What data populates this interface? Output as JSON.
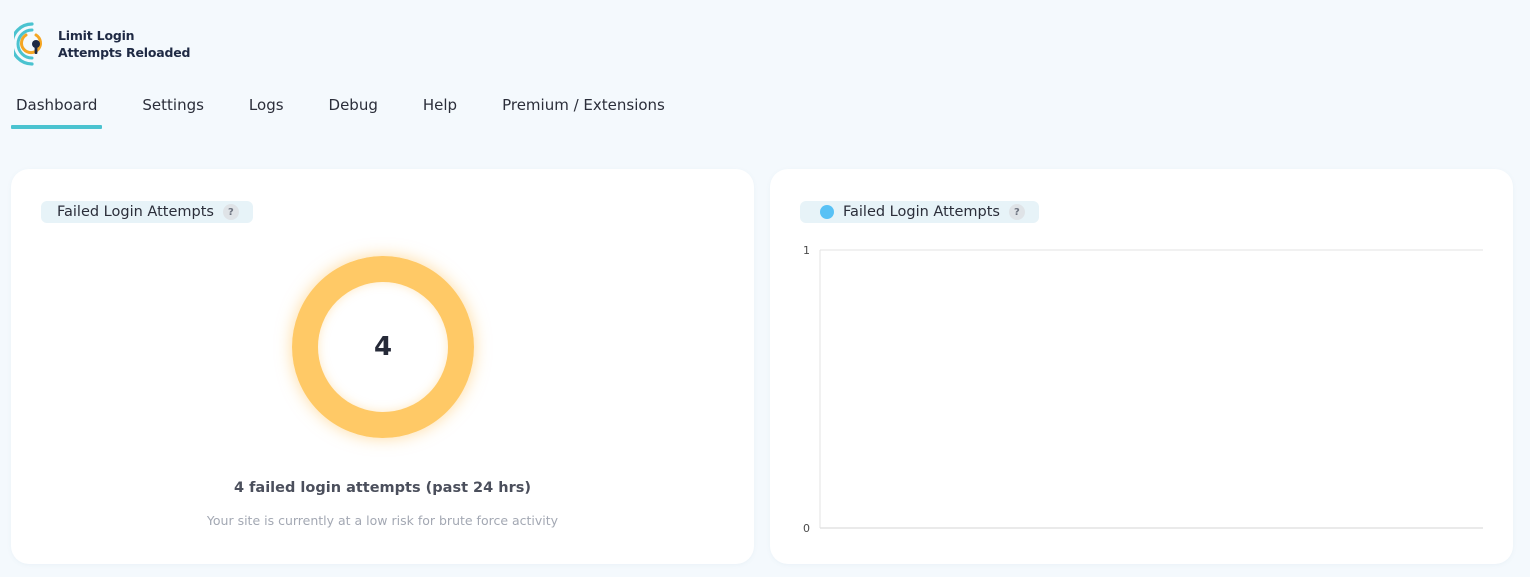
{
  "brand": {
    "name_line1": "Limit Login",
    "name_line2": "Attempts Reloaded",
    "colors": {
      "teal": "#4ac3d0",
      "orange": "#f5a623",
      "navy": "#1f2a44"
    }
  },
  "nav": {
    "items": [
      {
        "label": "Dashboard",
        "active": true
      },
      {
        "label": "Settings",
        "active": false
      },
      {
        "label": "Logs",
        "active": false
      },
      {
        "label": "Debug",
        "active": false
      },
      {
        "label": "Help",
        "active": false
      },
      {
        "label": "Premium / Extensions",
        "active": false
      }
    ]
  },
  "failed_card": {
    "title": "Failed Login Attempts",
    "help_glyph": "?",
    "count": "4",
    "summary": "4 failed login attempts (past 24 hrs)",
    "risk_text": "Your site is currently at a low risk for brute force activity",
    "ring_color": "#ffc966"
  },
  "chart_card": {
    "legend_label": "Failed Login Attempts",
    "help_glyph": "?",
    "legend_color": "#58c1f5"
  },
  "chart_data": {
    "type": "line",
    "series": [
      {
        "name": "Failed Login Attempts",
        "values": []
      }
    ],
    "y_ticks": [
      "1",
      "0"
    ],
    "ylim": [
      0,
      1
    ],
    "grid": true,
    "legend": "top-left"
  }
}
